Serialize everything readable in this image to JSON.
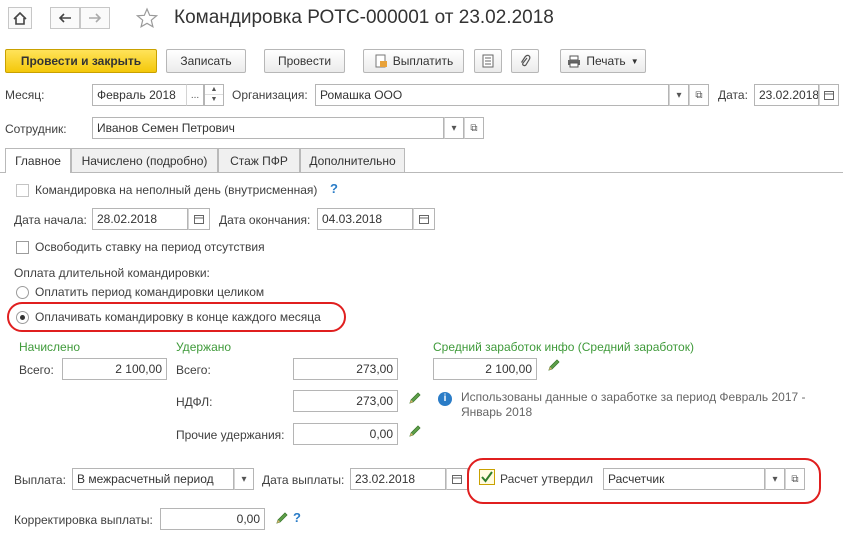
{
  "header": {
    "title": "Командировка РОТС-000001 от 23.02.2018"
  },
  "toolbar": {
    "post_close": "Провести и закрыть",
    "save": "Записать",
    "post": "Провести",
    "pay": "Выплатить",
    "print": "Печать"
  },
  "form": {
    "month_label": "Месяц:",
    "month_value": "Февраль 2018",
    "org_label": "Организация:",
    "org_value": "Ромашка ООО",
    "date_label": "Дата:",
    "date_value": "23.02.2018",
    "employee_label": "Сотрудник:",
    "employee_value": "Иванов Семен Петрович"
  },
  "tabs": [
    "Главное",
    "Начислено (подробно)",
    "Стаж ПФР",
    "Дополнительно"
  ],
  "main": {
    "partial_day_label": "Командировка на неполный день (внутрисменная)",
    "start_label": "Дата начала:",
    "start_value": "28.02.2018",
    "end_label": "Дата окончания:",
    "end_value": "04.03.2018",
    "release_rate_label": "Освободить ставку на период отсутствия",
    "long_trip_label": "Оплата длительной командировки:",
    "option_whole": "Оплатить период командировки целиком",
    "option_monthly": "Оплачивать командировку в конце каждого месяца",
    "accrued_header": "Начислено",
    "accrued_total_label": "Всего:",
    "accrued_total": "2 100,00",
    "withheld_header": "Удержано",
    "withheld_total_label": "Всего:",
    "withheld_total": "273,00",
    "ndfl_label": "НДФЛ:",
    "ndfl_value": "273,00",
    "other_label": "Прочие удержания:",
    "other_value": "0,00",
    "avg_header": "Средний заработок инфо (Средний заработок)",
    "avg_value": "2 100,00",
    "info_text_line1": "Использованы данные о заработке за период Февраль 2017 -",
    "info_text_line2": "Январь 2018",
    "payout_label": "Выплата:",
    "payout_value": "В межрасчетный период",
    "payout_date_label": "Дата выплаты:",
    "payout_date_value": "23.02.2018",
    "approved_label": "Расчет утвердил",
    "approved_value": "Расчетчик",
    "correction_label": "Корректировка выплаты:",
    "correction_value": "0,00",
    "question_mark": "?",
    "ellipsis": "..."
  },
  "colors": {
    "accent_yellow": "#f4c80a",
    "green_header": "#3f9a3a",
    "highlight_red": "#e01f1f",
    "info_blue": "#2a7cc7"
  }
}
